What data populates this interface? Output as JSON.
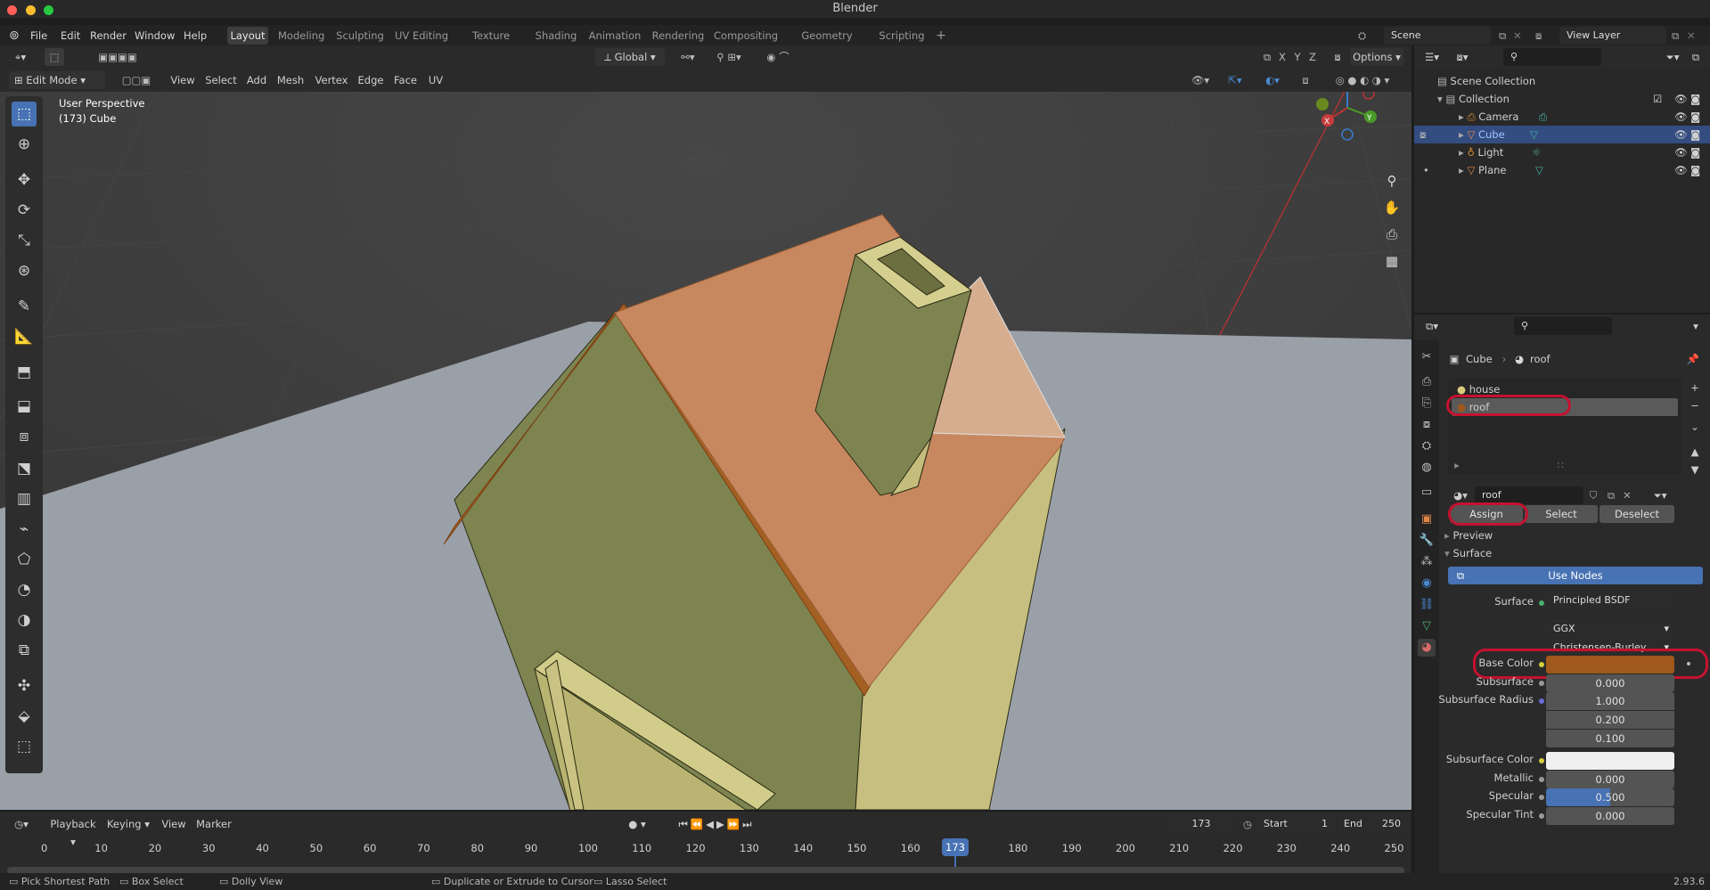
{
  "window": {
    "title": "Blender"
  },
  "menu": {
    "items": [
      "File",
      "Edit",
      "Render",
      "Window",
      "Help"
    ]
  },
  "workspaces": [
    "Layout",
    "Modeling",
    "Sculpting",
    "UV Editing",
    "Texture Paint",
    "Shading",
    "Animation",
    "Rendering",
    "Compositing",
    "Geometry Nodes",
    "Scripting"
  ],
  "scene": {
    "name": "Scene",
    "view_layer": "View Layer"
  },
  "viewport": {
    "mode": "Edit Mode",
    "menus": [
      "View",
      "Select",
      "Add",
      "Mesh",
      "Vertex",
      "Edge",
      "Face",
      "UV"
    ],
    "transform_orientation": "Global",
    "options_label": "Options",
    "axes": [
      "X",
      "Y",
      "Z"
    ],
    "overlay_title": "User Perspective",
    "overlay_object": "(173) Cube",
    "gizmo_axes": [
      "X",
      "Y",
      "Z"
    ]
  },
  "timeline": {
    "menus": [
      "Playback",
      "Keying",
      "View",
      "Marker"
    ],
    "current_frame": "173",
    "start_label": "Start",
    "start": "1",
    "end_label": "End",
    "end": "250",
    "ticks": [
      "0",
      "10",
      "20",
      "30",
      "40",
      "50",
      "60",
      "70",
      "80",
      "90",
      "100",
      "110",
      "120",
      "130",
      "140",
      "150",
      "160",
      "17",
      "180",
      "190",
      "200",
      "210",
      "220",
      "230",
      "240",
      "250"
    ]
  },
  "status": {
    "items": [
      "Pick Shortest Path",
      "Box Select",
      "Dolly View",
      "Duplicate or Extrude to Cursor",
      "Lasso Select"
    ],
    "version": "2.93.6"
  },
  "outliner": {
    "root": "Scene Collection",
    "collection": "Collection",
    "items": [
      {
        "name": "Camera",
        "selected": false
      },
      {
        "name": "Cube",
        "selected": true
      },
      {
        "name": "Light",
        "selected": false
      },
      {
        "name": "Plane",
        "selected": false
      }
    ]
  },
  "properties": {
    "breadcrumb_object": "Cube",
    "breadcrumb_material": "roof",
    "slots": [
      "house",
      "roof"
    ],
    "material_name": "roof",
    "assign": "Assign",
    "select": "Select",
    "deselect": "Deselect",
    "preview": "Preview",
    "surface_panel": "Surface",
    "use_nodes": "Use Nodes",
    "surface_label": "Surface",
    "surface_value": "Principled BSDF",
    "distribution": "GGX",
    "subsurface_method": "Christensen-Burley",
    "base_color_label": "Base Color",
    "base_color": "#a0581c",
    "subsurface_label": "Subsurface",
    "subsurface": "0.000",
    "subsurface_radius_label": "Subsurface Radius",
    "subsurface_radius": [
      "1.000",
      "0.200",
      "0.100"
    ],
    "subsurface_color_label": "Subsurface Color",
    "metallic_label": "Metallic",
    "metallic": "0.000",
    "specular_label": "Specular",
    "specular": "0.500",
    "specular_fill": 0.5,
    "specular_tint_label": "Specular Tint",
    "specular_tint": "0.000"
  }
}
